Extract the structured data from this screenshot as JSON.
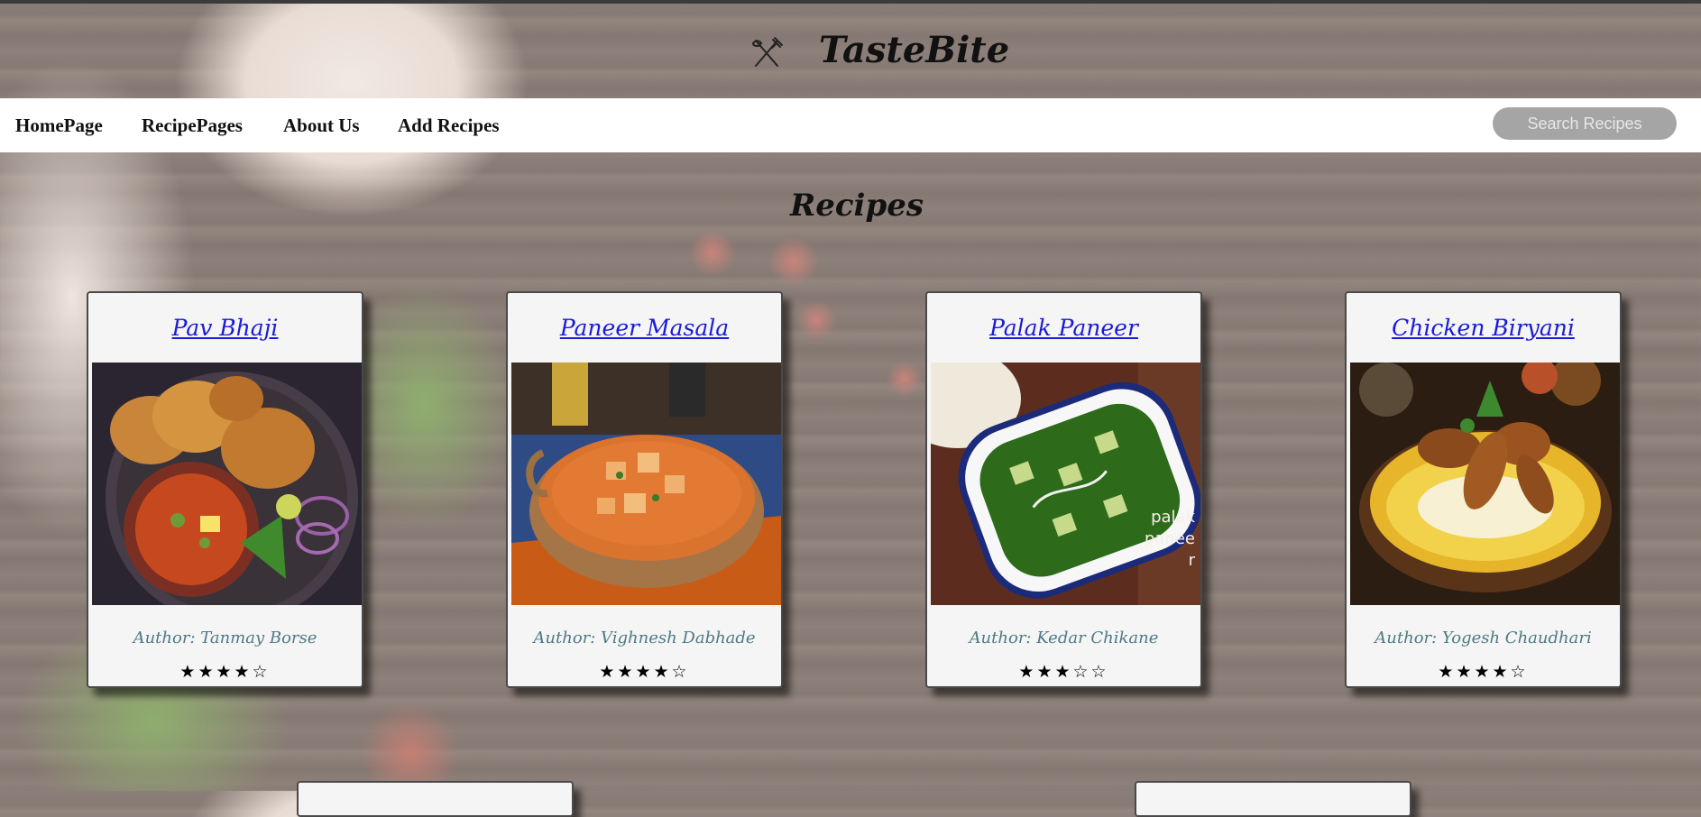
{
  "brand": {
    "name": "TasteBite",
    "logo_icon": "fork-knife-icon"
  },
  "nav": {
    "links": [
      "HomePage",
      "RecipePages",
      "About Us",
      "Add Recipes"
    ],
    "search_placeholder": "Search Recipes"
  },
  "section": {
    "title": "Recipes"
  },
  "recipes": [
    {
      "name": "Pav Bhaji",
      "author": "Author: Tanmay Borse",
      "rating": 4,
      "max_rating": 5,
      "stars": "★★★★☆"
    },
    {
      "name": "Paneer Masala",
      "author": "Author: Vighnesh Dabhade",
      "rating": 4,
      "max_rating": 5,
      "stars": "★★★★☆"
    },
    {
      "name": "Palak Paneer",
      "author": "Author: Kedar Chikane",
      "rating": 3,
      "max_rating": 5,
      "stars": "★★★☆☆"
    },
    {
      "name": "Chicken Biryani",
      "author": "Author: Yogesh Chaudhari",
      "rating": 4,
      "max_rating": 5,
      "stars": "★★★★☆"
    }
  ],
  "image_labels": {
    "palak_paneer": "palak paneer"
  },
  "colors": {
    "title_link": "#1a1ad8",
    "author": "#4e7a86",
    "search_bg": "#a5a5a5"
  }
}
